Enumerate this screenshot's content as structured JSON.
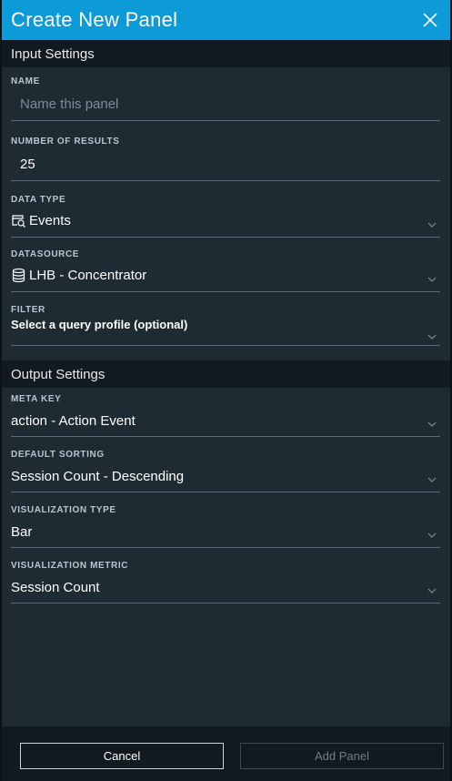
{
  "dialog": {
    "title": "Create New Panel"
  },
  "input_settings": {
    "header": "Input Settings",
    "name": {
      "label": "NAME",
      "value": "",
      "placeholder": "Name this panel"
    },
    "num_results": {
      "label": "NUMBER OF RESULTS",
      "value": "25"
    },
    "data_type": {
      "label": "DATA TYPE",
      "value": "Events",
      "icon": "events-icon"
    },
    "datasource": {
      "label": "DATASOURCE",
      "value": "LHB - Concentrator",
      "icon": "database-icon"
    },
    "filter": {
      "label": "FILTER",
      "value": "Select a query profile (optional)"
    }
  },
  "output_settings": {
    "header": "Output Settings",
    "meta_key": {
      "label": "META KEY",
      "value": "action - Action Event"
    },
    "default_sorting": {
      "label": "DEFAULT SORTING",
      "value": "Session Count - Descending"
    },
    "viz_type": {
      "label": "VISUALIZATION TYPE",
      "value": "Bar"
    },
    "viz_metric": {
      "label": "VISUALIZATION METRIC",
      "value": "Session Count"
    }
  },
  "footer": {
    "cancel_label": "Cancel",
    "add_label": "Add Panel"
  },
  "colors": {
    "title_bar": "#0d9ad9",
    "background": "#1f2b33",
    "section_header": "#111a20",
    "disabled_text": "#6e7c86"
  }
}
